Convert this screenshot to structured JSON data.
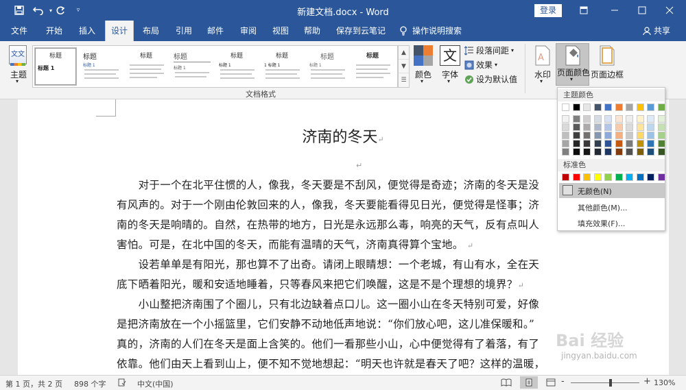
{
  "titlebar": {
    "title": "新建文档.docx - Word",
    "login": "登录",
    "save_icon": "save-icon",
    "undo_icon": "undo-icon",
    "redo_icon": "redo-icon",
    "qat_icon": "customize-quick-access-icon"
  },
  "tabs": [
    "文件",
    "开始",
    "插入",
    "设计",
    "布局",
    "引用",
    "邮件",
    "审阅",
    "视图",
    "帮助",
    "保存到云笔记"
  ],
  "tell_me": "操作说明搜索",
  "share": "共享",
  "ribbon": {
    "theme": "主题",
    "doc_format": "文档格式",
    "colors": "颜色",
    "fonts": "字体",
    "font_icon_glyph": "文",
    "theme_icon_glyph": "文文",
    "para_spacing": "段落间距",
    "effects": "效果",
    "set_default": "设为默认值",
    "watermark": "水印",
    "page_color": "页面颜色",
    "page_border": "页面边框",
    "style_thumbs": [
      {
        "head": "标题",
        "sub": "标题 1"
      },
      {
        "head": "标题",
        "sub": "标题 1"
      },
      {
        "head": "标题",
        "sub": ""
      },
      {
        "head": "标题",
        "sub": "标题 1"
      },
      {
        "head": "标题",
        "sub": "标题 1"
      },
      {
        "head": "标题",
        "sub": "1 标题 1"
      },
      {
        "head": "标题",
        "sub": "标题 1"
      },
      {
        "head": "标题",
        "sub": ""
      }
    ]
  },
  "dropdown": {
    "theme_colors": "主题颜色",
    "standard_colors": "标准色",
    "no_color": "无颜色(N)",
    "more_colors": "其他颜色(M)...",
    "fill_effects": "填充效果(F)...",
    "theme_top": [
      "#ffffff",
      "#000000",
      "#e7e6e6",
      "#44546a",
      "#4472c4",
      "#ed7d31",
      "#a5a5a5",
      "#ffc000",
      "#5b9bd5",
      "#70ad47"
    ],
    "theme_shades": [
      [
        "#f2f2f2",
        "#7f7f7f",
        "#d0cece",
        "#d6dce4",
        "#d9e2f3",
        "#fbe5d5",
        "#ededed",
        "#fff2cc",
        "#deebf6",
        "#e2efd9"
      ],
      [
        "#d9d9d9",
        "#595959",
        "#aeaaaa",
        "#adb9ca",
        "#b4c6e7",
        "#f7cbac",
        "#dbdbdb",
        "#fee599",
        "#bdd7ee",
        "#c5e0b3"
      ],
      [
        "#bfbfbf",
        "#3f3f3f",
        "#757070",
        "#8496b0",
        "#8eaadb",
        "#f4b083",
        "#c9c9c9",
        "#ffd965",
        "#9cc3e5",
        "#a8d08d"
      ],
      [
        "#a5a5a5",
        "#262626",
        "#3a3838",
        "#323f4f",
        "#2f5496",
        "#c45911",
        "#7b7b7b",
        "#bf9000",
        "#2e75b5",
        "#538135"
      ],
      [
        "#7f7f7f",
        "#0c0c0c",
        "#171616",
        "#222a35",
        "#1f3864",
        "#833c0b",
        "#525252",
        "#7f6000",
        "#1f4e79",
        "#375623"
      ]
    ],
    "standard": [
      "#c00000",
      "#ff0000",
      "#ffc000",
      "#ffff00",
      "#92d050",
      "#00b050",
      "#00b0f0",
      "#0070c0",
      "#002060",
      "#7030a0"
    ]
  },
  "doc": {
    "title": "济南的冬天",
    "lines": [
      "　　对于一个在北平住惯的人，像我，冬天要是不刮风，便觉得是奇迹；济南的冬天是没",
      "有风声的。对于一个刚由伦敦回来的人，像我，冬天要能看得见日光，便觉得是怪事；济",
      "南的冬天是响晴的。自然，在热带的地方，日光是永远那么毒，响亮的天气，反有点叫人",
      "害怕。可是，在北中国的冬天，而能有温晴的天气，济南真得算个宝地。",
      "　　设若单单是有阳光，那也算不了出奇。请闭上眼睛想：一个老城，有山有水，全在天",
      "底下晒着阳光，暖和安适地睡着，只等春风来把它们唤醒，这是不是个理想的境界？",
      "　　小山整把济南围了个圈儿，只有北边缺着点口儿。这一圈小山在冬天特别可爱，好像",
      "是把济南放在一个小摇篮里，它们安静不动地低声地说：“你们放心吧，这儿准保暖和。”",
      "真的，济南的人们在冬天是面上含笑的。他们一看那些小山，心中便觉得有了着落，有了",
      "依靠。他们由天上看到山上，便不知不觉地想起：“明天也许就是春天了吧？这样的温暖，"
    ]
  },
  "status": {
    "page": "第 1 页，共 2 页",
    "words": "898 个字",
    "lang": "中文(中国)",
    "zoom": "130%",
    "zoom_out": "-",
    "zoom_in": "+"
  },
  "watermark": {
    "text": "Bai 经验",
    "url": "jingyan.baidu.com"
  }
}
